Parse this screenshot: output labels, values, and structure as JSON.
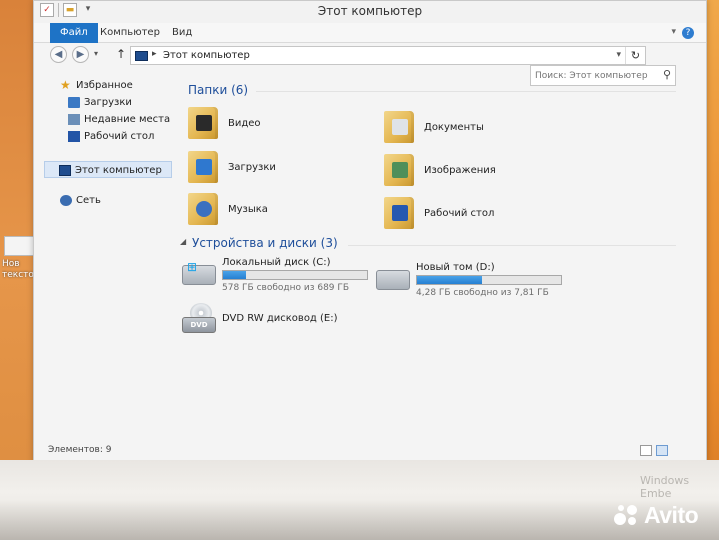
{
  "window": {
    "title": "Этот компьютер",
    "ribbon_tabs": [
      "Файл",
      "Компьютер",
      "Вид"
    ],
    "help_label": "?"
  },
  "nav": {
    "back_glyph": "◀",
    "forward_glyph": "▶",
    "recent_glyph": "▾",
    "up_glyph": "↑",
    "address_separator": "▸",
    "address_path": "Этот компьютер",
    "address_dropdown_glyph": "▾",
    "refresh_glyph": "↻"
  },
  "search": {
    "placeholder": "Поиск: Этот компьютер",
    "icon_glyph": "⚲"
  },
  "sidebar": {
    "favorites_label": "Избранное",
    "items": [
      {
        "label": "Загрузки"
      },
      {
        "label": "Недавние места"
      },
      {
        "label": "Рабочий стол"
      }
    ],
    "this_pc_label": "Этот компьютер",
    "network_label": "Сеть"
  },
  "folders_group": {
    "header": "Папки (6)",
    "folders": [
      {
        "label": "Видео",
        "icon": "video-folder-icon"
      },
      {
        "label": "Документы",
        "icon": "documents-folder-icon"
      },
      {
        "label": "Загрузки",
        "icon": "downloads-folder-icon"
      },
      {
        "label": "Изображения",
        "icon": "pictures-folder-icon"
      },
      {
        "label": "Музыка",
        "icon": "music-folder-icon"
      },
      {
        "label": "Рабочий стол",
        "icon": "desktop-folder-icon"
      }
    ]
  },
  "drives_group": {
    "header": "Устройства и диски (3)",
    "drives": [
      {
        "name": "Локальный диск (C:)",
        "free_text": "578 ГБ свободно из 689 ГБ",
        "used_fraction": 0.16
      },
      {
        "name": "Новый том (D:)",
        "free_text": "4,28 ГБ свободно из 7,81 ГБ",
        "used_fraction": 0.45
      },
      {
        "name": "DVD RW дисковод (E:)",
        "badge": "DVD"
      }
    ]
  },
  "status": {
    "items_count": "Элементов: 9"
  },
  "desktop": {
    "icon_label": "Нов\nтексто",
    "watermark": "Windows Embe",
    "avito_label": "Avito"
  },
  "colors": {
    "accent": "#1e73c6",
    "group_header": "#1e4e9a",
    "drive_bar": "#2680d2",
    "desktop_bg": "#ec9638"
  }
}
